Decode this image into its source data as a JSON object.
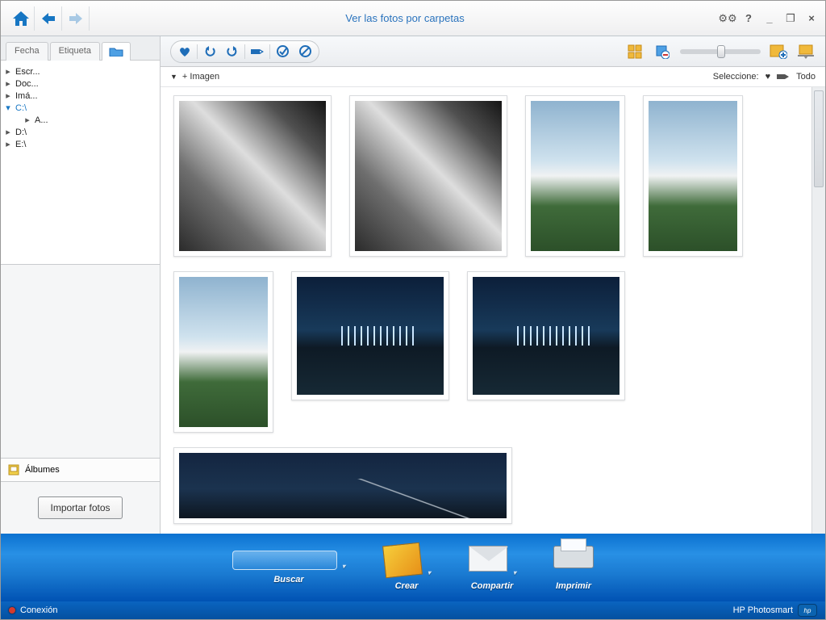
{
  "header": {
    "title": "Ver las fotos por carpetas"
  },
  "sidebar": {
    "tabs": {
      "fecha": "Fecha",
      "etiqueta": "Etiqueta"
    },
    "tree": {
      "n0": "Escr...",
      "n1": "Doc...",
      "n2": "Imá...",
      "n3": "C:\\",
      "n3a": "A...",
      "n4": "D:\\",
      "n5": "E:\\"
    },
    "albums_label": "Álbumes",
    "import_label": "Importar fotos"
  },
  "gallery": {
    "group_label": "+ Imagen",
    "select_label": "Seleccione:",
    "select_all": "Todo"
  },
  "dock": {
    "buscar": "Buscar",
    "crear": "Crear",
    "compartir": "Compartir",
    "imprimir": "Imprimir"
  },
  "status": {
    "connection": "Conexión",
    "brand": "HP Photosmart"
  }
}
